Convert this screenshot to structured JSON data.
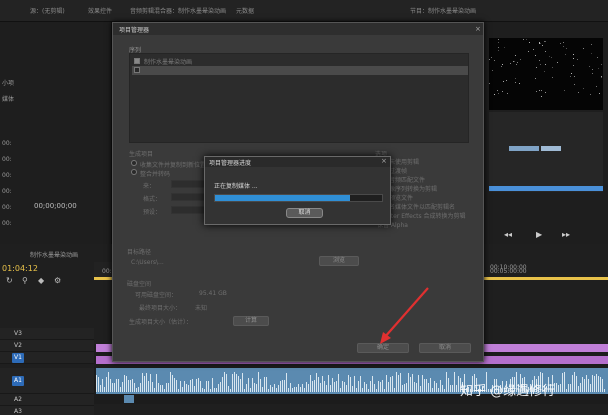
{
  "app": {
    "tabs": [
      "源：(无剪辑)",
      "效果控件",
      "音频剪辑混合器：制作水墨晕染动画",
      "元数据"
    ],
    "program_tab": "节目：制作水墨晕染动画",
    "source_timecode": "00;00;00;00",
    "timeline_timecode": "01:04:12",
    "timeline_tab": "制作水墨晕染动画",
    "ruler_marks": [
      "00:05:00:00",
      "00:10:00:00"
    ],
    "tracks": [
      {
        "name": "V3",
        "selected": false
      },
      {
        "name": "V2",
        "selected": false
      },
      {
        "name": "V1",
        "selected": true
      },
      {
        "name": "A1",
        "selected": true
      },
      {
        "name": "A2",
        "selected": false
      },
      {
        "name": "A3",
        "selected": false
      }
    ],
    "left_labels": [
      "小项",
      "媒体",
      "00:",
      "00:",
      "00:",
      "00:",
      "00:",
      "00:"
    ]
  },
  "dialog": {
    "title": "项目管理器",
    "sequence_section": "序列",
    "sequences": [
      "制作水墨晕染动画",
      ""
    ],
    "resource_section": "生成项目",
    "option_1": "收集文件并复制到新位置",
    "option_2": "整合并转码",
    "source_label": "来：",
    "format_label": "格式：",
    "preset_label": "预设：",
    "options_section": "选项",
    "options": [
      "排除未使用剪辑",
      "包含过渡帧",
      "包含音频匹配文件",
      "将图像序列转换为剪辑",
      "包含预览文件",
      "重命名媒体文件以匹配剪辑名",
      "将 After Effects 合成转换为剪辑",
      "保留 Alpha"
    ],
    "target_section": "目标路径",
    "target_path": "C:\\Users\\...",
    "browse_label": "浏览",
    "disk_section": "磁盘空间",
    "disk_available": "可用磁盘空间：",
    "disk_available_value": "95.41 GB",
    "project_size": "最终项目大小：",
    "project_size_value": "未知",
    "generated_size": "生成项目大小（估计）：",
    "calc_label": "计算",
    "ok_label": "确定",
    "cancel_label": "取消"
  },
  "progress": {
    "title": "项目管理器进度",
    "status": "正在复制媒体 ...",
    "cancel_label": "取消",
    "fraction": 0.81
  },
  "watermark": "知乎 @缘遇修行",
  "colors": {
    "progress_fill": "#2f8fd6",
    "track_selected": "#2d6bb8",
    "video_clip": "#c07fd8",
    "audio_clip": "#5b8ab0",
    "arrow": "#e03030"
  }
}
